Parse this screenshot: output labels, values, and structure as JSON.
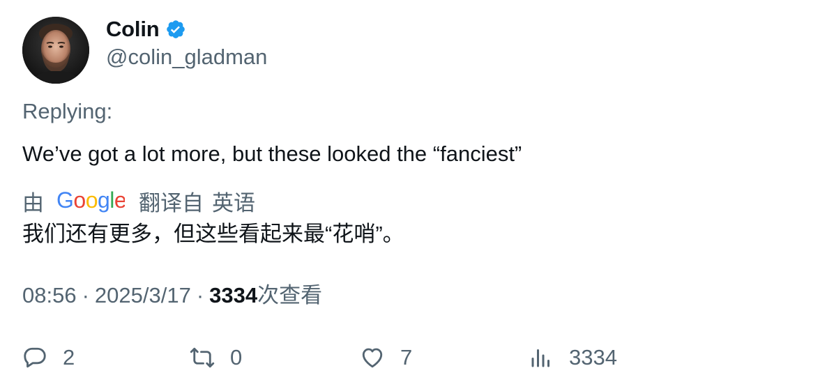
{
  "author": {
    "display_name": "Colin",
    "handle": "@colin_gladman",
    "verified": true,
    "verified_color": "#1d9bf0"
  },
  "replying_label": "Replying:",
  "tweet": {
    "text": "We’ve got a lot more, but these looked the “fanciest”"
  },
  "translation": {
    "by_label": "由",
    "provider": "Google",
    "from_label": "翻译自",
    "language": "英语",
    "text": "我们还有更多，但这些看起来最“花哨”。"
  },
  "meta": {
    "time": "08:56",
    "date": "2025/3/17",
    "views_count": "3334",
    "views_label": "次查看",
    "separator": "·"
  },
  "actions": {
    "reply_count": "2",
    "retweet_count": "0",
    "like_count": "7",
    "views_count": "3334"
  },
  "icons": {
    "verified": "verified-badge-icon",
    "reply": "reply-icon",
    "retweet": "retweet-icon",
    "like": "heart-icon",
    "views": "analytics-icon"
  },
  "colors": {
    "text_primary": "#0f1419",
    "text_secondary": "#536471",
    "google_blue": "#4285F4",
    "google_red": "#EA4335",
    "google_yellow": "#FBBC05",
    "google_green": "#34A853"
  }
}
